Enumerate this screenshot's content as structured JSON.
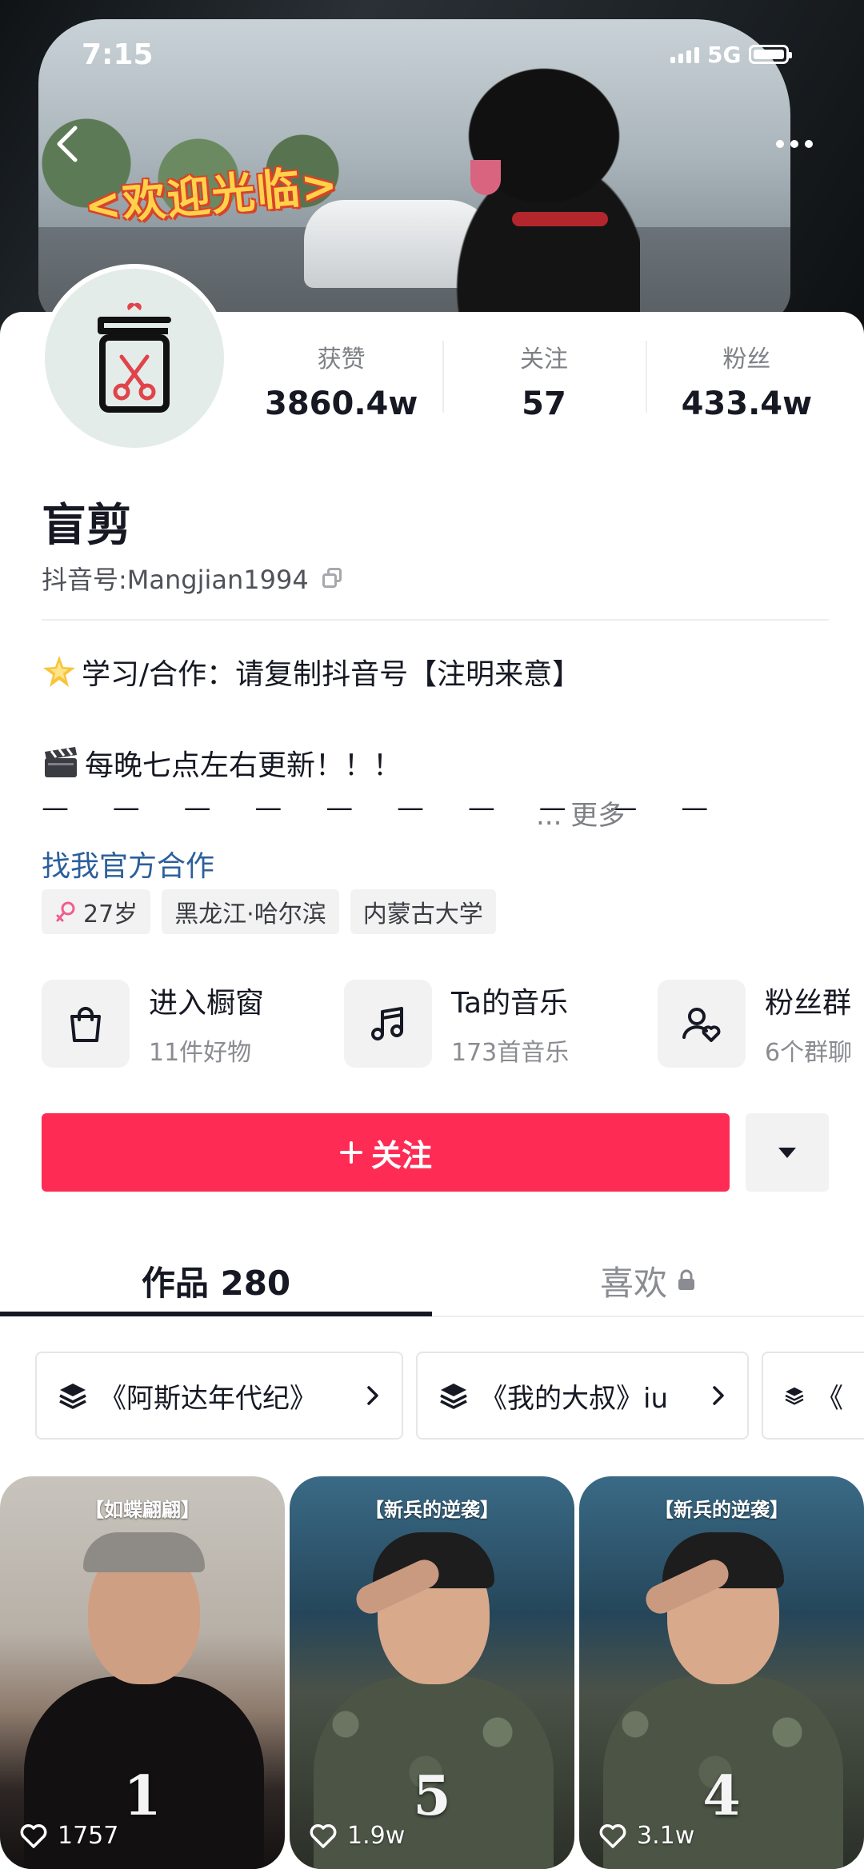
{
  "status_bar": {
    "time": "7:15",
    "network": "5G"
  },
  "banner": {
    "welcome_text": "<欢迎光临>"
  },
  "profile": {
    "stats": [
      {
        "label": "获赞",
        "value": "3860.4w"
      },
      {
        "label": "关注",
        "value": "57"
      },
      {
        "label": "粉丝",
        "value": "433.4w"
      }
    ],
    "nickname": "盲剪",
    "account_id": "抖音号:Mangjian1994",
    "bio_lines": [
      "学习/合作：请复制抖音号【注明来意】",
      "每晚七点左右更新！！！"
    ],
    "bio_dashes": "— — — — — — — — — —",
    "more_label": "... 更多",
    "official_link": "找我官方合作",
    "tags": [
      "27岁",
      "黑龙江·哈尔滨",
      "内蒙古大学"
    ]
  },
  "services": [
    {
      "title": "进入橱窗",
      "subtitle": "11件好物",
      "icon": "shopping-bag-icon"
    },
    {
      "title": "Ta的音乐",
      "subtitle": "173首音乐",
      "icon": "music-note-icon"
    },
    {
      "title": "粉丝群",
      "subtitle": "6个群聊",
      "icon": "fan-group-icon"
    }
  ],
  "actions": {
    "follow_label": "关注"
  },
  "tabs": {
    "works_label": "作品 280",
    "likes_label": "喜欢"
  },
  "collections": [
    {
      "label": "《阿斯达年代纪》"
    },
    {
      "label": "《我的大叔》iu"
    },
    {
      "label": "《"
    }
  ],
  "videos": [
    {
      "title": "【如蝶翩翩】",
      "number": "1",
      "likes": "1757"
    },
    {
      "title": "【新兵的逆袭】",
      "number": "5",
      "likes": "1.9w"
    },
    {
      "title": "【新兵的逆袭】",
      "number": "4",
      "likes": "3.1w"
    }
  ],
  "colors": {
    "accent": "#fe2c55",
    "link": "#2c5f9c",
    "text": "#161823",
    "muted": "#8a8c91"
  }
}
